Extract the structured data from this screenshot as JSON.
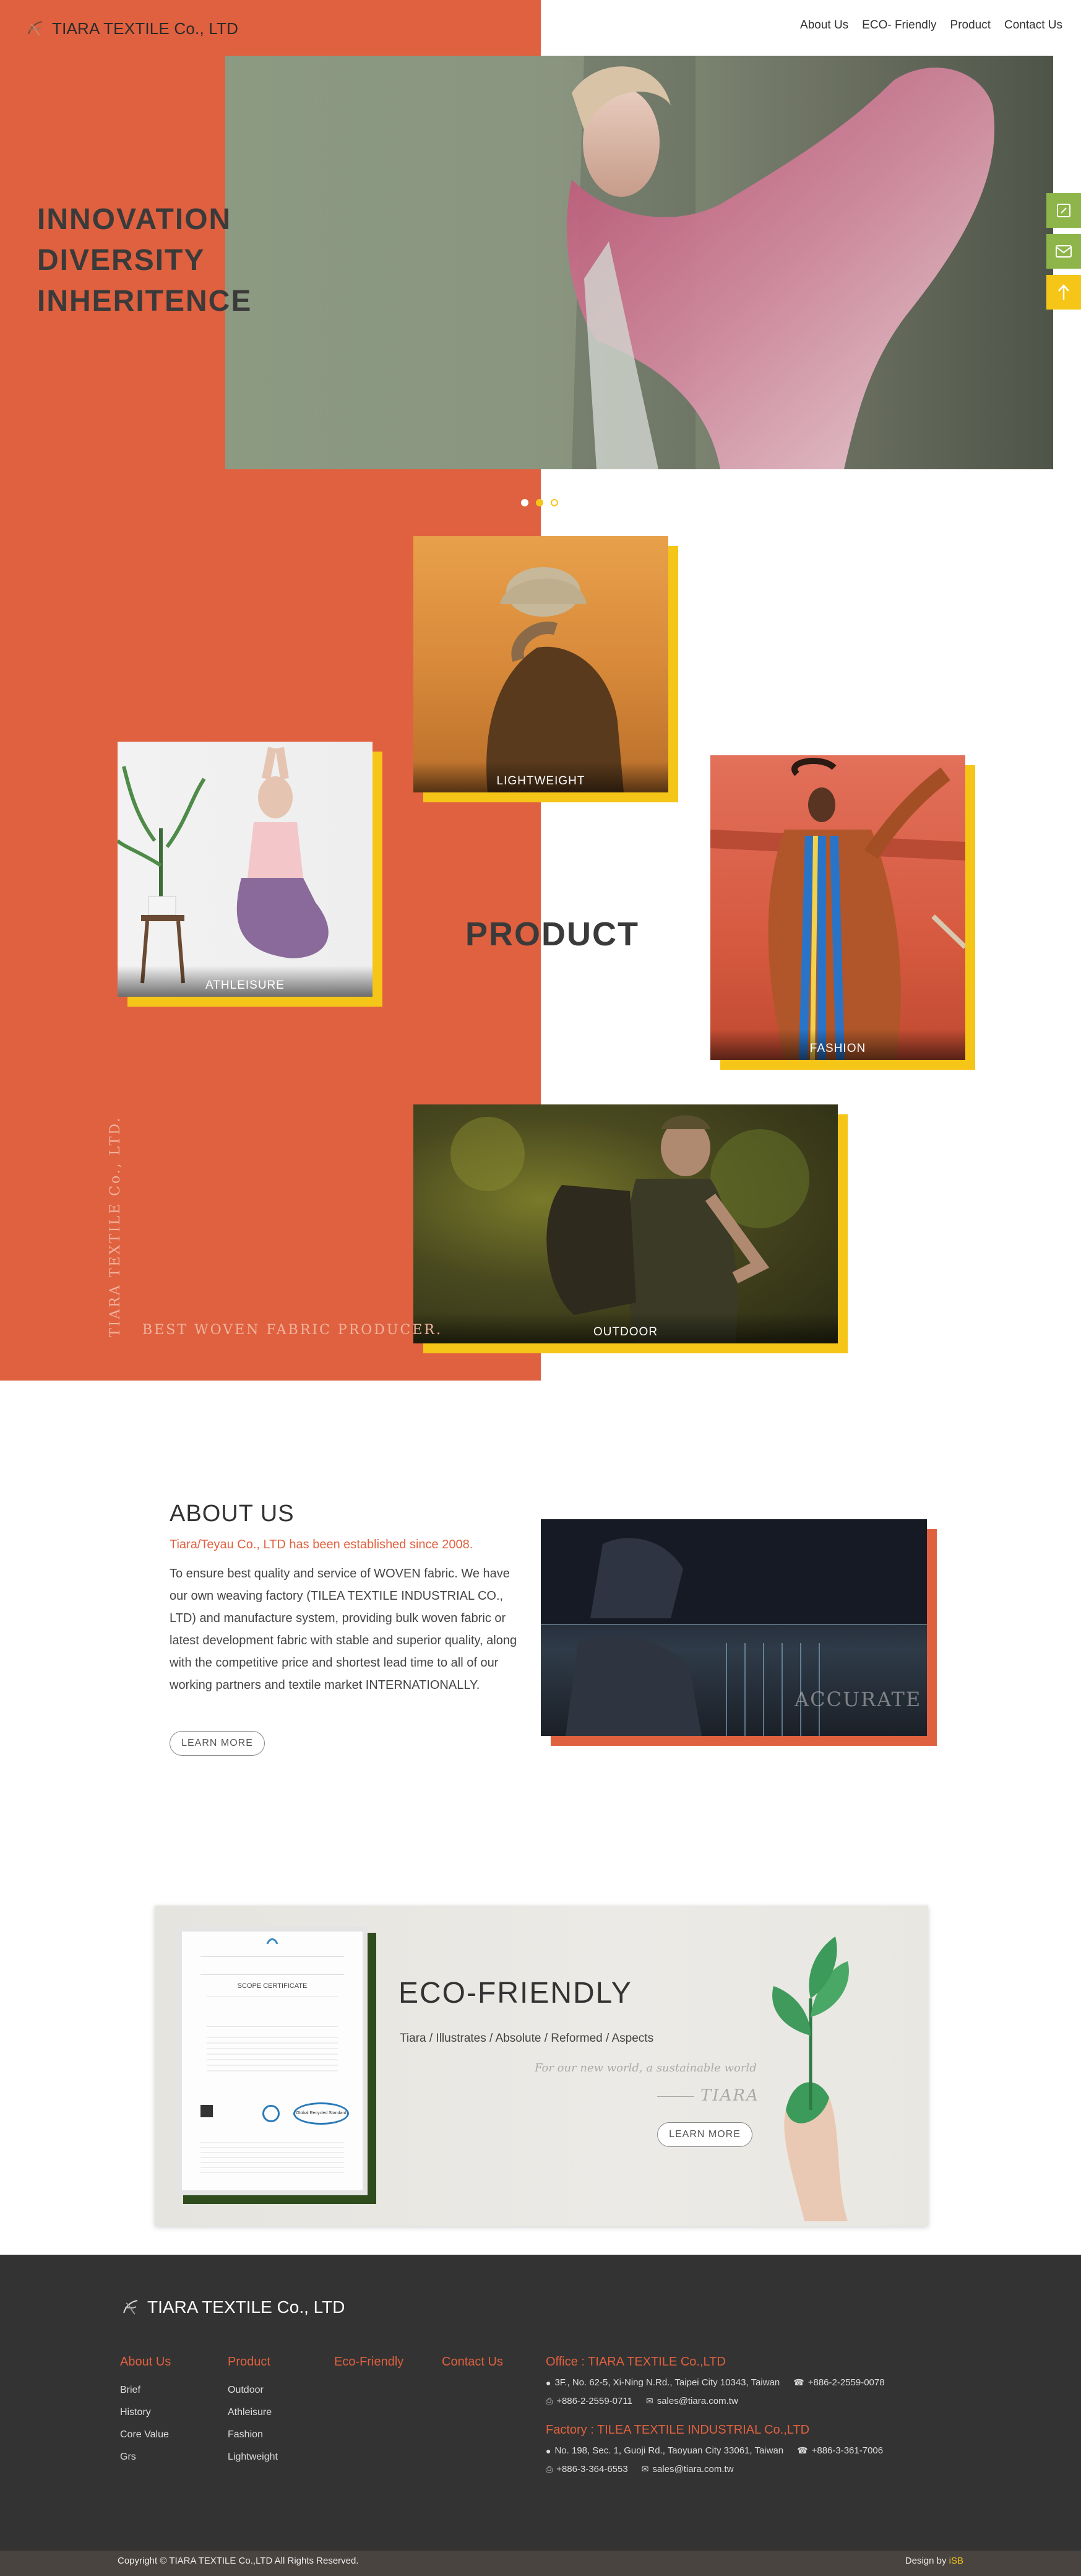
{
  "header": {
    "brand": "TIARA TEXTILE Co., LTD",
    "nav": [
      "About Us",
      "ECO- Friendly",
      "Product",
      "Contact Us"
    ]
  },
  "hero": {
    "lines": [
      "INNOVATION",
      "DIVERSITY",
      "INHERITENCE"
    ],
    "slides": 3,
    "active_slide": 2
  },
  "products": {
    "title": "PRODUCT",
    "items": [
      "LIGHTWEIGHT",
      "ATHLEISURE",
      "FASHION",
      "OUTDOOR"
    ],
    "vertical_brand": "TIARA TEXTILE Co., LTD.",
    "tagline": "BEST WOVEN FABRIC PRODUCER."
  },
  "about": {
    "title": "ABOUT US",
    "subtitle": "Tiara/Teyau Co., LTD has been established since 2008.",
    "body": "To ensure best quality and service of WOVEN fabric. We have our own weaving factory (TILEA TEXTILE INDUSTRIAL CO., LTD) and manufacture system, providing bulk woven fabric or latest development fabric with stable and superior quality, along with the competitive price and shortest lead time to all of our working partners and textile market INTERNATIONALLY.",
    "button": "LEARN MORE",
    "image_overlay": "ACCURATE"
  },
  "eco": {
    "title": "ECO-FRIENDLY",
    "subtitle": "Tiara / Illustrates / Absolute / Reformed / Aspects",
    "quote": "For our new world, a sustainable world",
    "signature": "TIARA",
    "button": "LEARN MORE",
    "certificate_title": "SCOPE CERTIFICATE",
    "certificate_badge": "Global Recycled Standard"
  },
  "footer": {
    "brand": "TIARA TEXTILE Co., LTD",
    "columns": [
      {
        "heading": "About Us",
        "items": [
          "Brief",
          "History",
          "Core Value",
          "Grs"
        ]
      },
      {
        "heading": "Product",
        "items": [
          "Outdoor",
          "Athleisure",
          "Fashion",
          "Lightweight"
        ]
      },
      {
        "heading": "Eco-Friendly",
        "items": []
      },
      {
        "heading": "Contact Us",
        "items": []
      }
    ],
    "office": {
      "heading": "Office : TIARA TEXTILE Co.,LTD",
      "address": "3F., No. 62-5, Xi-Ning N.Rd., Taipei City 10343, Taiwan",
      "phone": "+886-2-2559-0078",
      "fax": "+886-2-2559-0711",
      "email": "sales@tiara.com.tw"
    },
    "factory": {
      "heading": "Factory : TILEA TEXTILE INDUSTRIAL Co.,LTD",
      "address": "No. 198, Sec. 1, Guoji Rd., Taoyuan City 33061, Taiwan",
      "phone": "+886-3-361-7006",
      "fax": "+886-3-364-6553",
      "email": "sales@tiara.com.tw"
    },
    "copyright": "Copyright © TIARA TEXTILE Co.,LTD All Rights Reserved.",
    "design_prefix": "Design by",
    "design_by": "iSB"
  },
  "colors": {
    "accent": "#e0613f",
    "yellow": "#f5c518",
    "green": "#8db54a",
    "footer": "#333333"
  }
}
